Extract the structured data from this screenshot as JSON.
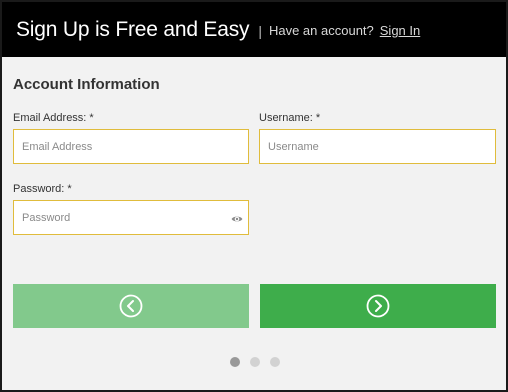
{
  "header": {
    "title": "Sign Up is Free and Easy",
    "separator": "|",
    "prompt": "Have an account?",
    "sign_in_link": "Sign In"
  },
  "form": {
    "section_title": "Account Information",
    "email": {
      "label": "Email Address: *",
      "placeholder": "Email Address",
      "value": ""
    },
    "username": {
      "label": "Username: *",
      "placeholder": "Username",
      "value": ""
    },
    "password": {
      "label": "Password: *",
      "placeholder": "Password",
      "value": "",
      "reveal_icon": "eye-icon"
    }
  },
  "navigation": {
    "back_icon": "chevron-left-circle-icon",
    "next_icon": "chevron-right-circle-icon",
    "back_enabled": false,
    "next_enabled": true
  },
  "pagination": {
    "total_steps": 3,
    "current_step": 1
  },
  "colors": {
    "header_bg": "#000000",
    "page_bg": "#f2f2f2",
    "input_border": "#e0bc3c",
    "back_button": "#82c98c",
    "next_button": "#3ead4b",
    "dot_active": "#999999",
    "dot_inactive": "#d2d2d2"
  }
}
